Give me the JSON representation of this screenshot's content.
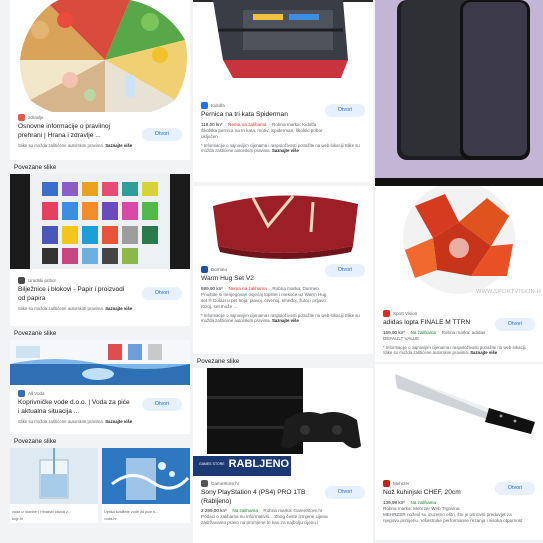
{
  "common": {
    "open_label": "Otvori",
    "related_label": "Povezane slike",
    "copyright_note": "Slike su možda zaštićene autorskim pravima.",
    "learn_more": "Saznajte više",
    "info_note": "* Informacije o najnovijim cijenama i raspoloživosti potražite na web-lokaciji",
    "info_note_tail": "Slike su možda zaštićene autorskim pravima."
  },
  "col1": {
    "food": {
      "source": "zdravlje",
      "title_line1": "Osnovne informacije o pravilnoj",
      "title_line2": "prehrani | Hrana i zdravlje ..."
    },
    "notebooks": {
      "source": "Uradski pribor",
      "title_line1": "Bilježnice i blokovi - Papir i proizvodi",
      "title_line2": "od papira"
    },
    "water": {
      "source": "All Voda",
      "title_line1": "Koprivničke vode d.o.o. | Voda za piće",
      "title_line2": "i aktualna situacija ..."
    },
    "mini_left_caption": "voda iz slavine | Hrvatski zavod z...",
    "mini_left_sub": "hzjz.hr",
    "mini_right_caption": "Uptika kvalitete vode za piće s...",
    "mini_right_sub": "voda.hr"
  },
  "col2": {
    "pencil": {
      "source": "Kidolfa",
      "title": "Pernica na tri kata Spiderman",
      "price": "119,00 kn*",
      "stock": "Nema na zalihama",
      "brand": "Robna marka: Kidolfa",
      "desc1": "Školska pernica na tri kata, motiv: Spiderman, školski pribor",
      "desc2": "uključen"
    },
    "blanket": {
      "source": "Dormeo",
      "title": "Warm Hug Set V2",
      "price": "599,90 kn*",
      "stock": "Nema na zalihama",
      "brand": "Robna marka: Dormeo",
      "desc1": "Priuštite si nenjegovan osjećaj topline i mekoće uz Warm Hug",
      "desc2": "set ® Dolazi u pet boja: plavoj, crvenoj, smeđoj, žutoj i prljavo",
      "desc3": "rozoj, set može ..."
    },
    "ps4": {
      "banner_small": "GAMES STORE",
      "banner_big": "RABLJENO",
      "source": "GameStore.hr",
      "title_line1": "Sony PlayStation 4 (PS4) PRO 1TB",
      "title_line2": "(Rabljeno)",
      "price": "2.299,00 kn*",
      "stock": "Na zalihama",
      "brand": "Robna marka: GameStore.hr",
      "desc1": "Podaci o zalihama su informativni... Zbog česte izmjene cijena",
      "desc2": "zadržavamo pravo na promjene te kao za najbolju cijenu i"
    }
  },
  "col3": {
    "ball": {
      "watermark": "WWW.SPORTVISION.H",
      "source": "Sport Vision",
      "title": "adidas lopta FINALE M TTRN",
      "price": "169,90 kn*",
      "stock": "Na zalihama",
      "brand": "Robna marka: adidas",
      "value": "DEFAULT VALUE"
    },
    "knife": {
      "source": "Mehrzer",
      "title": "Nož kuhinjski CHEF, 20cm",
      "price": "139,99 kn*",
      "stock": "Na zalihama",
      "brand": "Robna marka: Mehrzer Web Trgovina",
      "desc1": "MEHRZER noževi su izuzetno oštri, što je osnovni preduvjet za",
      "desc2": "njegovu primjenu. Višestruke performanse rezanja i visoka otpornost"
    }
  },
  "colors": {
    "accent": "#1a73e8",
    "out_of_stock": "#d93025",
    "in_stock": "#188038"
  }
}
